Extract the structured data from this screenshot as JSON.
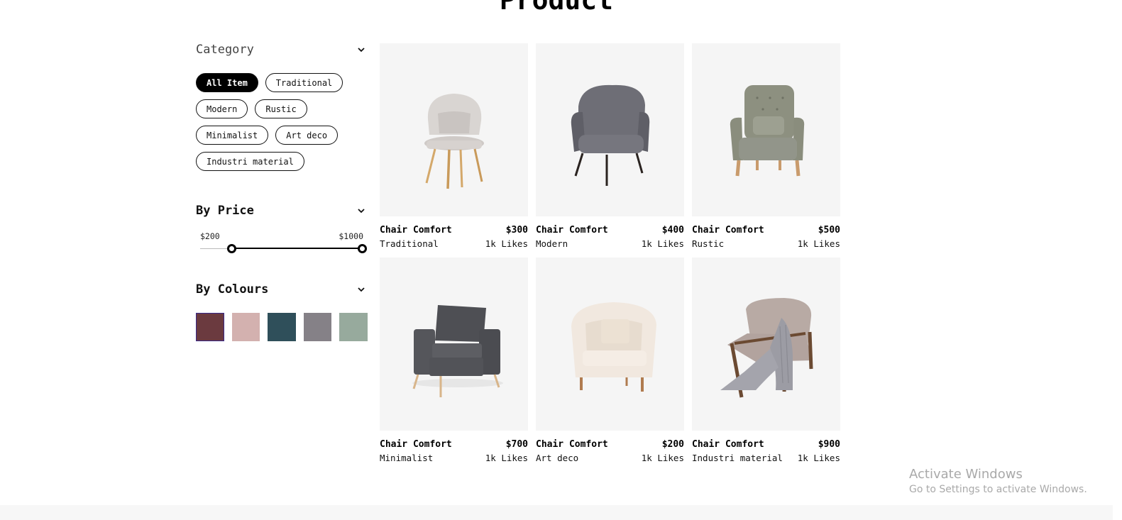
{
  "page": {
    "title": "Product"
  },
  "filters": {
    "category": {
      "title": "Category",
      "chips": [
        {
          "label": "All Item",
          "active": true
        },
        {
          "label": "Traditional",
          "active": false
        },
        {
          "label": "Modern",
          "active": false
        },
        {
          "label": "Rustic",
          "active": false
        },
        {
          "label": "Minimalist",
          "active": false
        },
        {
          "label": "Art deco",
          "active": false
        },
        {
          "label": "Industri material",
          "active": false
        }
      ]
    },
    "price": {
      "title": "By Price",
      "min_label": "$200",
      "max_label": "$1000"
    },
    "colours": {
      "title": "By Colours",
      "swatches": [
        "#6b3a3f",
        "#d3b1af",
        "#2f4f5a",
        "#858187",
        "#97aa9d"
      ],
      "selected_index": 0
    }
  },
  "products": [
    {
      "name": "Chair Comfort",
      "price": "$300",
      "category": "Traditional",
      "likes": "1k Likes",
      "image": "armchair-light-grey-wooden-legs"
    },
    {
      "name": "Chair Comfort",
      "price": "$400",
      "category": "Modern",
      "likes": "1k Likes",
      "image": "armchair-dark-grey"
    },
    {
      "name": "Chair Comfort",
      "price": "$500",
      "category": "Rustic",
      "likes": "1k Likes",
      "image": "armchair-sage-tufted"
    },
    {
      "name": "Chair Comfort",
      "price": "$700",
      "category": "Minimalist",
      "likes": "1k Likes",
      "image": "armchair-charcoal-box"
    },
    {
      "name": "Chair Comfort",
      "price": "$200",
      "category": "Art deco",
      "likes": "1k Likes",
      "image": "tub-chair-cream"
    },
    {
      "name": "Chair Comfort",
      "price": "$900",
      "category": "Industri material",
      "likes": "1k Likes",
      "image": "lounge-chair-throw"
    }
  ],
  "watermark": {
    "line1": "Activate Windows",
    "line2": "Go to Settings to activate Windows."
  }
}
